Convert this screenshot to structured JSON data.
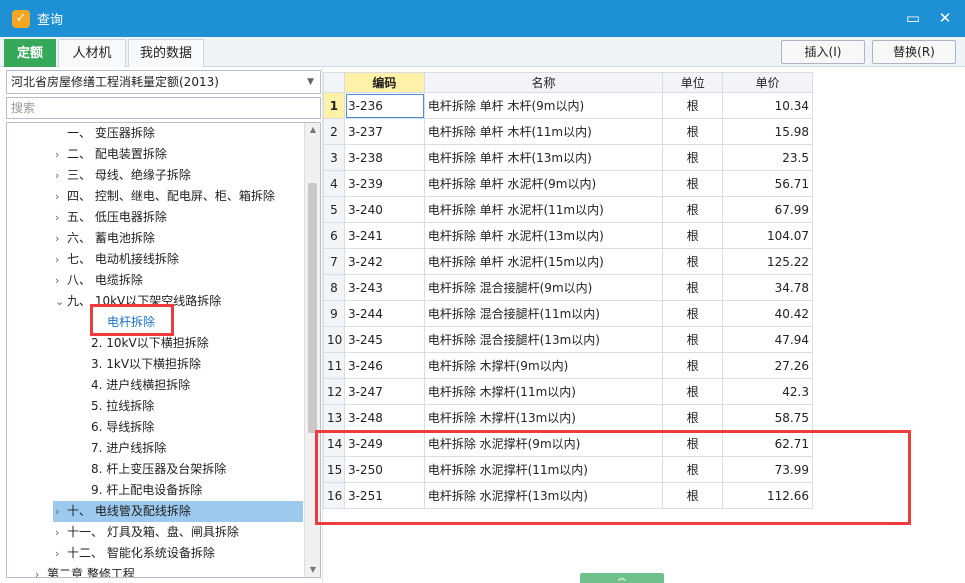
{
  "window": {
    "title": "查询",
    "app_icon": "app-logo-icon",
    "minimize_icon": "maximize-icon",
    "close_icon": "close-icon"
  },
  "tabs": [
    {
      "label": "定额",
      "active": true
    },
    {
      "label": "人材机",
      "active": false
    },
    {
      "label": "我的数据",
      "active": false
    }
  ],
  "actions": {
    "insert": "插入(I)",
    "replace": "替换(R)"
  },
  "left": {
    "quota_library": "河北省房屋修缮工程消耗量定额(2013)",
    "search_placeholder": "搜索",
    "tree": [
      {
        "label": "一、 变压器拆除",
        "chevron": ""
      },
      {
        "label": "二、 配电装置拆除",
        "chevron": "›"
      },
      {
        "label": "三、 母线、绝缘子拆除",
        "chevron": "›"
      },
      {
        "label": "四、 控制、继电、配电屏、柜、箱拆除",
        "chevron": "›"
      },
      {
        "label": "五、 低压电器拆除",
        "chevron": "›"
      },
      {
        "label": "六、 蓄电池拆除",
        "chevron": "›"
      },
      {
        "label": "七、 电动机接线拆除",
        "chevron": "›"
      },
      {
        "label": "八、 电缆拆除",
        "chevron": "›"
      },
      {
        "label": "九、 10kV以下架空线路拆除",
        "chevron": "⌄"
      },
      {
        "label": "电杆拆除",
        "chevron": ""
      },
      {
        "label": "2. 10kV以下横担拆除",
        "chevron": ""
      },
      {
        "label": "3. 1kV以下横担拆除",
        "chevron": ""
      },
      {
        "label": "4. 进户线横担拆除",
        "chevron": ""
      },
      {
        "label": "5. 拉线拆除",
        "chevron": ""
      },
      {
        "label": "6. 导线拆除",
        "chevron": ""
      },
      {
        "label": "7. 进户线拆除",
        "chevron": ""
      },
      {
        "label": "8. 杆上变压器及台架拆除",
        "chevron": ""
      },
      {
        "label": "9. 杆上配电设备拆除",
        "chevron": ""
      },
      {
        "label": "十、 电线管及配线拆除",
        "chevron": "›"
      },
      {
        "label": "十一、 灯具及箱、盘、闸具拆除",
        "chevron": "›"
      },
      {
        "label": "十二、 智能化系统设备拆除",
        "chevron": "›"
      },
      {
        "label": "第二章 整修工程",
        "chevron": "›"
      }
    ]
  },
  "grid": {
    "headers": {
      "code": "编码",
      "name": "名称",
      "unit": "单位",
      "price": "单价"
    },
    "rows": [
      {
        "idx": "1",
        "code": "3-236",
        "name": "电杆拆除 单杆 木杆(9m以内)",
        "unit": "根",
        "price": "10.34"
      },
      {
        "idx": "2",
        "code": "3-237",
        "name": "电杆拆除 单杆 木杆(11m以内)",
        "unit": "根",
        "price": "15.98"
      },
      {
        "idx": "3",
        "code": "3-238",
        "name": "电杆拆除 单杆 木杆(13m以内)",
        "unit": "根",
        "price": "23.5"
      },
      {
        "idx": "4",
        "code": "3-239",
        "name": "电杆拆除 单杆 水泥杆(9m以内)",
        "unit": "根",
        "price": "56.71"
      },
      {
        "idx": "5",
        "code": "3-240",
        "name": "电杆拆除 单杆 水泥杆(11m以内)",
        "unit": "根",
        "price": "67.99"
      },
      {
        "idx": "6",
        "code": "3-241",
        "name": "电杆拆除 单杆 水泥杆(13m以内)",
        "unit": "根",
        "price": "104.07"
      },
      {
        "idx": "7",
        "code": "3-242",
        "name": "电杆拆除 单杆 水泥杆(15m以内)",
        "unit": "根",
        "price": "125.22"
      },
      {
        "idx": "8",
        "code": "3-243",
        "name": "电杆拆除 混合接腿杆(9m以内)",
        "unit": "根",
        "price": "34.78"
      },
      {
        "idx": "9",
        "code": "3-244",
        "name": "电杆拆除 混合接腿杆(11m以内)",
        "unit": "根",
        "price": "40.42"
      },
      {
        "idx": "10",
        "code": "3-245",
        "name": "电杆拆除 混合接腿杆(13m以内)",
        "unit": "根",
        "price": "47.94"
      },
      {
        "idx": "11",
        "code": "3-246",
        "name": "电杆拆除 木撑杆(9m以内)",
        "unit": "根",
        "price": "27.26"
      },
      {
        "idx": "12",
        "code": "3-247",
        "name": "电杆拆除 木撑杆(11m以内)",
        "unit": "根",
        "price": "42.3"
      },
      {
        "idx": "13",
        "code": "3-248",
        "name": "电杆拆除 木撑杆(13m以内)",
        "unit": "根",
        "price": "58.75"
      },
      {
        "idx": "14",
        "code": "3-249",
        "name": "电杆拆除 水泥撑杆(9m以内)",
        "unit": "根",
        "price": "62.71"
      },
      {
        "idx": "15",
        "code": "3-250",
        "name": "电杆拆除 水泥撑杆(11m以内)",
        "unit": "根",
        "price": "73.99"
      },
      {
        "idx": "16",
        "code": "3-251",
        "name": "电杆拆除 水泥撑杆(13m以内)",
        "unit": "根",
        "price": "112.66"
      }
    ]
  },
  "colors": {
    "titlebar": "#1e90d6",
    "active_tab": "#36a85a",
    "highlight": "#ee3b3b",
    "selected_row": "#9cc9ee"
  }
}
